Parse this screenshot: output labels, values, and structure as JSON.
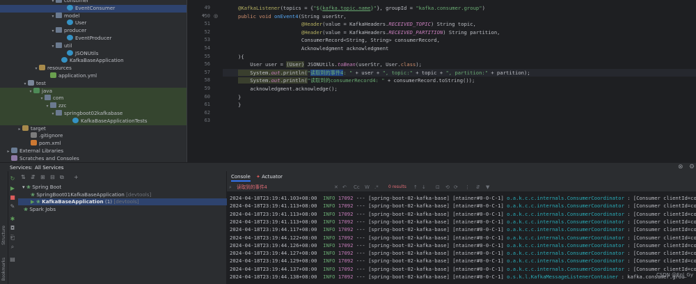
{
  "project_tree": [
    {
      "indent": 72,
      "arrow": "▾",
      "icon": "pkg",
      "label": "consumer",
      "state": ""
    },
    {
      "indent": 88,
      "arrow": "",
      "icon": "cls",
      "label": "EventConsumer",
      "state": "sel"
    },
    {
      "indent": 72,
      "arrow": "▾",
      "icon": "pkg",
      "label": "model",
      "state": ""
    },
    {
      "indent": 88,
      "arrow": "",
      "icon": "cls",
      "label": "User",
      "state": ""
    },
    {
      "indent": 72,
      "arrow": "▾",
      "icon": "pkg",
      "label": "producer",
      "state": ""
    },
    {
      "indent": 88,
      "arrow": "",
      "icon": "cls",
      "label": "EventProducer",
      "state": ""
    },
    {
      "indent": 72,
      "arrow": "▾",
      "icon": "pkg",
      "label": "util",
      "state": ""
    },
    {
      "indent": 88,
      "arrow": "",
      "icon": "cls",
      "label": "JSONUtils",
      "state": ""
    },
    {
      "indent": 80,
      "arrow": "",
      "icon": "cls",
      "label": "KafkaBaseApplication",
      "state": ""
    },
    {
      "indent": 48,
      "arrow": "▾",
      "icon": "res",
      "label": "resources",
      "state": ""
    },
    {
      "indent": 64,
      "arrow": "",
      "icon": "yml",
      "label": "application.yml",
      "state": ""
    },
    {
      "indent": 32,
      "arrow": "▾",
      "icon": "folder",
      "label": "test",
      "state": ""
    },
    {
      "indent": 40,
      "arrow": "▾",
      "icon": "test",
      "label": "java",
      "state": "hl"
    },
    {
      "indent": 56,
      "arrow": "▾",
      "icon": "pkg",
      "label": "com",
      "state": "hl"
    },
    {
      "indent": 64,
      "arrow": "▾",
      "icon": "pkg",
      "label": "zzc",
      "state": "hl"
    },
    {
      "indent": 72,
      "arrow": "▾",
      "icon": "pkg",
      "label": "springboot02kafkabase",
      "state": "hl"
    },
    {
      "indent": 96,
      "arrow": "",
      "icon": "cls",
      "label": "KafkaBaseApplicationTests",
      "state": "hl"
    },
    {
      "indent": 24,
      "arrow": "▸",
      "icon": "res",
      "label": "target",
      "state": ""
    },
    {
      "indent": 36,
      "arrow": "",
      "icon": "git",
      "label": ".gitignore",
      "state": ""
    },
    {
      "indent": 36,
      "arrow": "",
      "icon": "xml",
      "label": "pom.xml",
      "state": ""
    },
    {
      "indent": 8,
      "arrow": "▸",
      "icon": "lib",
      "label": "External Libraries",
      "state": ""
    },
    {
      "indent": 8,
      "arrow": "",
      "icon": "scr",
      "label": "Scratches and Consoles",
      "state": ""
    }
  ],
  "editor": {
    "line_numbers": [
      "49",
      "50",
      "51",
      "52",
      "53",
      "54",
      "55",
      "56",
      "57",
      "58",
      "59",
      "60",
      "61",
      "62",
      "63"
    ],
    "lines": [
      [
        {
          "c": "an",
          "t": "@KafkaListener"
        },
        {
          "c": "",
          "t": "(topics = {"
        },
        {
          "c": "st",
          "t": "\"${"
        },
        {
          "c": "st lnk",
          "t": "kafka.topic.name"
        },
        {
          "c": "st",
          "t": "}\""
        },
        {
          "c": "",
          "t": "}, groupId = "
        },
        {
          "c": "st",
          "t": "\"kafka.consumer.group\""
        },
        {
          "c": "",
          "t": ")"
        }
      ],
      [
        {
          "c": "kw",
          "t": "public void "
        },
        {
          "c": "fn",
          "t": "onEvent4"
        },
        {
          "c": "",
          "t": "(String userStr,"
        }
      ],
      [
        {
          "c": "",
          "t": "                     "
        },
        {
          "c": "an",
          "t": "@Header"
        },
        {
          "c": "",
          "t": "(value = KafkaHeaders."
        },
        {
          "c": "it",
          "t": "RECEIVED_TOPIC"
        },
        {
          "c": "",
          "t": ") String topic,"
        }
      ],
      [
        {
          "c": "",
          "t": "                     "
        },
        {
          "c": "an",
          "t": "@Header"
        },
        {
          "c": "",
          "t": "(value = KafkaHeaders."
        },
        {
          "c": "it",
          "t": "RECEIVED_PARTITION"
        },
        {
          "c": "",
          "t": ") String partition,"
        }
      ],
      [
        {
          "c": "",
          "t": "                     ConsumerRecord<String, String> consumerRecord,"
        }
      ],
      [
        {
          "c": "",
          "t": "                     Acknowledgment acknowledgment"
        }
      ],
      [
        {
          "c": "",
          "t": "){"
        }
      ],
      [
        {
          "c": "",
          "t": "    User user = "
        },
        {
          "c": "hlbox",
          "t": "(User)"
        },
        {
          "c": "",
          "t": " JSONUtils."
        },
        {
          "c": "it",
          "t": "toBean"
        },
        {
          "c": "",
          "t": "(userStr, User."
        },
        {
          "c": "kw",
          "t": "class"
        },
        {
          "c": "",
          "t": ");"
        }
      ],
      [
        {
          "c": "hlbox",
          "t": "    System."
        },
        {
          "c": "hlbox it",
          "t": "out"
        },
        {
          "c": "hlbox",
          "t": ".println("
        },
        {
          "c": "st",
          "t": "\""
        },
        {
          "c": "st selw",
          "t": "读取到的事件4"
        },
        {
          "c": "st",
          "t": ": \""
        },
        {
          "c": "",
          "t": " + user + "
        },
        {
          "c": "st",
          "t": "\", topic:\""
        },
        {
          "c": "",
          "t": " + topic + "
        },
        {
          "c": "st",
          "t": "\", partition:\""
        },
        {
          "c": "",
          "t": " + partition);"
        }
      ],
      [
        {
          "c": "hlbox",
          "t": "    System."
        },
        {
          "c": "hlbox it",
          "t": "out"
        },
        {
          "c": "hlbox",
          "t": ".println("
        },
        {
          "c": "st",
          "t": "\"读取到的consumerRecord4: \""
        },
        {
          "c": "",
          "t": " + consumerRecord.toString());"
        }
      ],
      [
        {
          "c": "",
          "t": "    acknowledgment.acknowledge();"
        }
      ],
      [
        {
          "c": "",
          "t": "}"
        }
      ],
      [
        {
          "c": "",
          "t": "}"
        }
      ],
      [
        {
          "c": "",
          "t": ""
        }
      ],
      [
        {
          "c": "",
          "t": ""
        }
      ]
    ]
  },
  "services": {
    "label": "Services:",
    "tab": "All Services",
    "tree": [
      {
        "indent": 6,
        "text": "▾ ",
        "bold": "",
        "main": "Spring Boot",
        "dev": "",
        "sel": false
      },
      {
        "indent": 18,
        "text": "",
        "bold": "",
        "main": "SpringBoot01KafkaBaseApplication",
        "dev": " [devtools]",
        "sel": false
      },
      {
        "indent": 18,
        "text": "▶ ",
        "bold": "KafkaBaseApplication",
        "main": " (1)",
        "dev": " [devtools]",
        "sel": true
      },
      {
        "indent": 8,
        "text": "",
        "bold": "",
        "main": "Spark Jobs",
        "dev": "",
        "sel": false
      }
    ]
  },
  "console": {
    "tabs": [
      "Console",
      "Actuator"
    ],
    "search_query": "读取到的事件4",
    "result_count": "0 results",
    "timestamp_date": "2024-04-18T23:",
    "log_rows": [
      {
        "time": "19:41.103+08:00",
        "logger": "o.a.k.c.c.internals.ConsumerCoordinator",
        "tail": " : [Consumer clientId=co"
      },
      {
        "time": "19:41.113+08:00",
        "logger": "o.a.k.c.c.internals.ConsumerCoordinator",
        "tail": " : [Consumer clientId=co"
      },
      {
        "time": "19:41.113+08:00",
        "logger": "o.a.k.c.c.internals.ConsumerCoordinator",
        "tail": " : [Consumer clientId=co"
      },
      {
        "time": "19:41.113+08:00",
        "logger": "o.a.k.c.c.internals.ConsumerCoordinator",
        "tail": " : [Consumer clientId=co"
      },
      {
        "time": "19:44.117+08:00",
        "logger": "o.a.k.c.c.internals.ConsumerCoordinator",
        "tail": " : [Consumer clientId=co"
      },
      {
        "time": "19:44.122+08:00",
        "logger": "o.a.k.c.c.internals.ConsumerCoordinator",
        "tail": " : [Consumer clientId=co"
      },
      {
        "time": "19:44.126+08:00",
        "logger": "o.a.k.c.c.internals.ConsumerCoordinator",
        "tail": " : [Consumer clientId=co"
      },
      {
        "time": "19:44.127+08:00",
        "logger": "o.a.k.c.c.internals.ConsumerCoordinator",
        "tail": " : [Consumer clientId=co"
      },
      {
        "time": "19:44.129+08:00",
        "logger": "o.a.k.c.c.internals.ConsumerCoordinator",
        "tail": " : [Consumer clientId=co"
      },
      {
        "time": "19:44.137+08:00",
        "logger": "o.a.k.c.c.internals.ConsumerCoordinator",
        "tail": " : [Consumer clientId=co"
      },
      {
        "time": "19:44.138+08:00",
        "logger": "o.s.k.l.KafkaMessageListenerContainer",
        "tail": " : kafka.consumer.grou"
      }
    ],
    "level": "INFO",
    "pid": "17092",
    "thread": "[spring-boot-02-kafka-base] [ntainer#0-0-C-1]",
    "sep": "---"
  },
  "left_strip_labels": [
    "Structure",
    "Bookmarks"
  ],
  "watermark": "CSDN @Enl_Gy"
}
